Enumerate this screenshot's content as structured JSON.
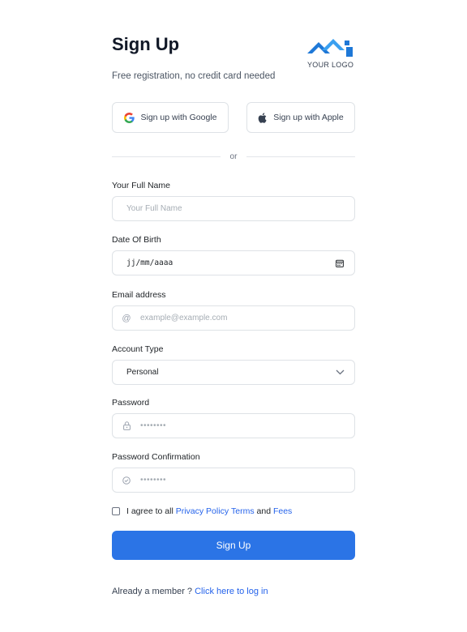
{
  "header": {
    "title": "Sign Up",
    "subtitle": "Free registration, no credit card needed",
    "logo_text": "YOUR LOGO"
  },
  "social": {
    "google_label": "Sign up with Google",
    "apple_label": "Sign up with Apple"
  },
  "divider_text": "or",
  "form": {
    "full_name": {
      "label": "Your Full Name",
      "placeholder": "Your Full Name"
    },
    "dob": {
      "label": "Date Of Birth",
      "value": "jj/mm/aaaa"
    },
    "email": {
      "label": "Email address",
      "placeholder": "example@example.com"
    },
    "account_type": {
      "label": "Account Type",
      "selected": "Personal"
    },
    "password": {
      "label": "Password",
      "placeholder": "••••••••"
    },
    "password_confirmation": {
      "label": "Password Confirmation",
      "placeholder": "••••••••"
    }
  },
  "agree": {
    "prefix": "I agree to all",
    "privacy_link": "Privacy Policy",
    "terms_link": "Terms",
    "and": "and",
    "fees_link": "Fees"
  },
  "submit_label": "Sign Up",
  "footer": {
    "text": "Already a member ?",
    "link": "Click here to log in"
  },
  "colors": {
    "primary": "#2b74e6",
    "link": "#2563eb",
    "border": "#dee2e6"
  },
  "icons": [
    "google-icon",
    "apple-icon",
    "at-icon",
    "calendar-icon",
    "chevron-down-icon",
    "lock-icon",
    "check-circle-icon"
  ]
}
